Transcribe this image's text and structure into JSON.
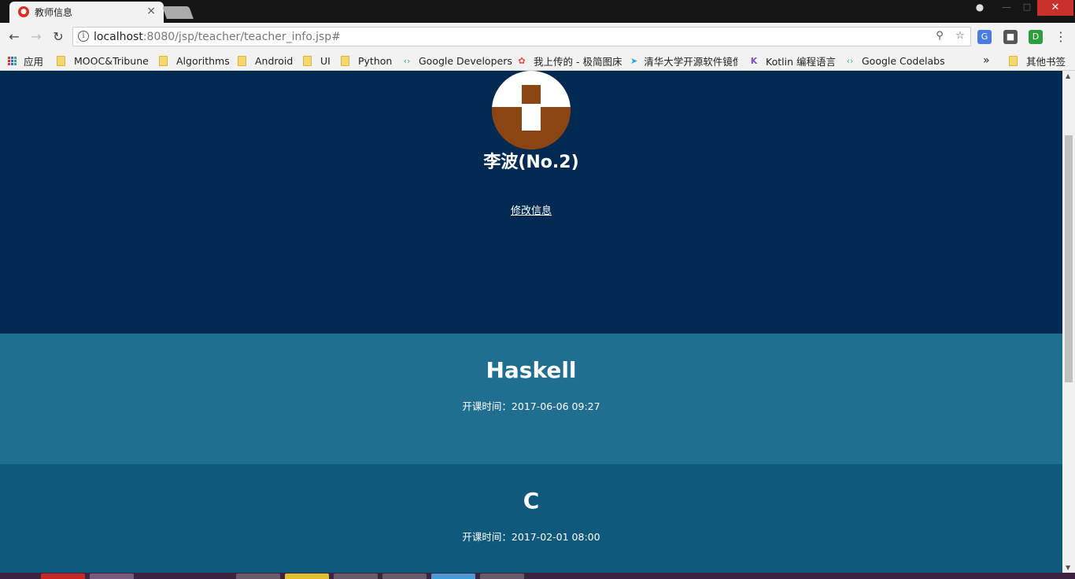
{
  "browser": {
    "tab_title": "教师信息",
    "tab_close": "×",
    "url_host": "localhost",
    "url_rest": ":8080/jsp/teacher/teacher_info.jsp#",
    "ext_translate": "G",
    "ext_d": "D",
    "bookmarks_overflow": "»"
  },
  "bookmarks": [
    {
      "label": "应用",
      "kind": "apps"
    },
    {
      "label": "MOOC&Tribune",
      "kind": "folder"
    },
    {
      "label": "Algorithms",
      "kind": "folder"
    },
    {
      "label": "Android",
      "kind": "folder"
    },
    {
      "label": "UI",
      "kind": "folder"
    },
    {
      "label": "Python",
      "kind": "folder"
    },
    {
      "label": "Google Developers",
      "kind": "site"
    },
    {
      "label": "我上传的 - 极简图床",
      "kind": "site"
    },
    {
      "label": "清华大学开源软件镜像",
      "kind": "site"
    },
    {
      "label": "Kotlin 编程语言",
      "kind": "site"
    },
    {
      "label": "Google Codelabs",
      "kind": "site"
    },
    {
      "label": "其他书签",
      "kind": "folder"
    }
  ],
  "profile": {
    "name": "李波(No.2)",
    "edit_link": "修改信息"
  },
  "courses": [
    {
      "name": "Haskell",
      "time": "开课时间：2017-06-06 09:27",
      "bg": "#206f90"
    },
    {
      "name": "C",
      "time": "开课时间：2017-02-01 08:00",
      "bg": "#0f5a7c"
    }
  ],
  "colors": {
    "header_bg": "#002a52",
    "avatar_brown": "#8b4513",
    "avatar_white": "#ffffff"
  }
}
